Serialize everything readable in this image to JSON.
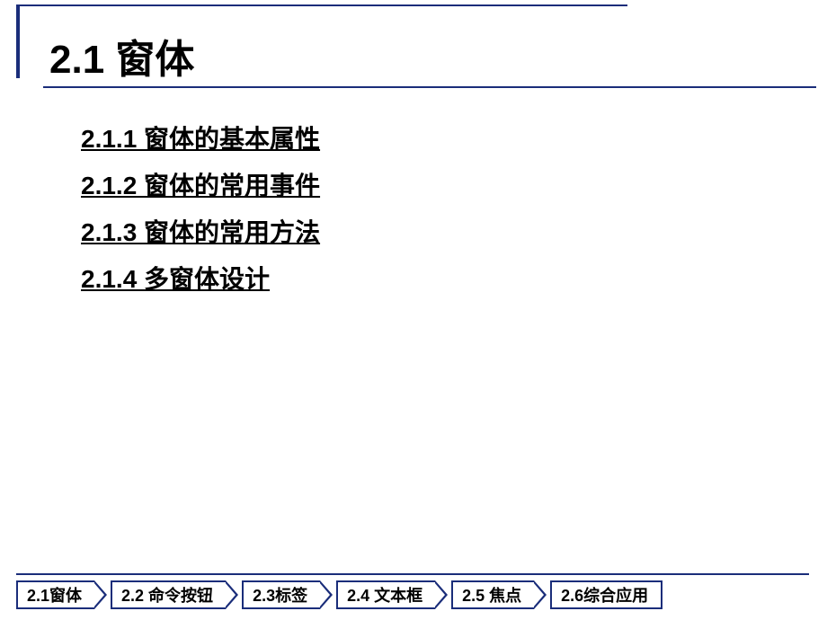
{
  "title": "2.1 窗体",
  "topics": [
    "2.1.1 窗体的基本属性",
    "2.1.2 窗体的常用事件",
    "2.1.3 窗体的常用方法",
    "2.1.4 多窗体设计"
  ],
  "nav": [
    "2.1窗体",
    "2.2 命令按钮",
    "2.3标签",
    "2.4 文本框",
    "2.5 焦点",
    "2.6综合应用"
  ]
}
